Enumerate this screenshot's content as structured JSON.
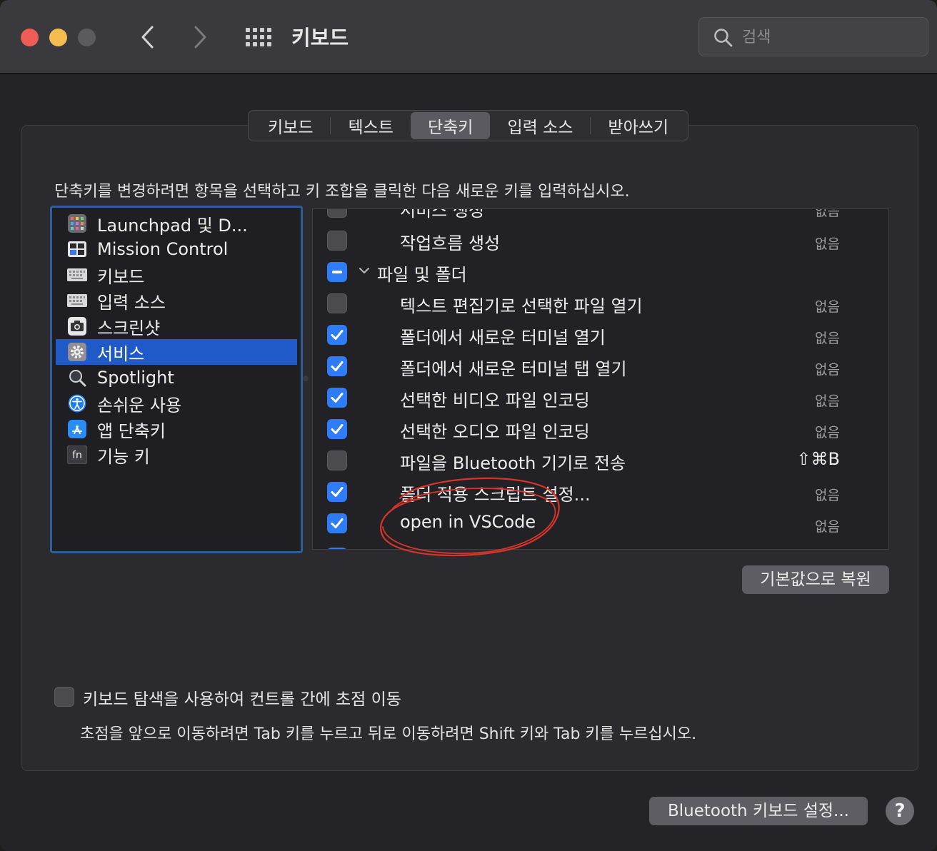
{
  "window": {
    "title": "키보드",
    "search_placeholder": "검색"
  },
  "tabs": [
    {
      "label": "키보드",
      "active": false
    },
    {
      "label": "텍스트",
      "active": false
    },
    {
      "label": "단축키",
      "active": true
    },
    {
      "label": "입력 소스",
      "active": false
    },
    {
      "label": "받아쓰기",
      "active": false
    }
  ],
  "instruction": "단축키를 변경하려면 항목을 선택하고 키 조합을 클릭한 다음 새로운 키를 입력하십시오.",
  "categories": [
    {
      "label": "Launchpad 및 D...",
      "icon": "launchpad-icon"
    },
    {
      "label": "Mission Control",
      "icon": "mission-control-icon"
    },
    {
      "label": "키보드",
      "icon": "keyboard-icon"
    },
    {
      "label": "입력 소스",
      "icon": "keyboard-icon"
    },
    {
      "label": "스크린샷",
      "icon": "screenshot-icon"
    },
    {
      "label": "서비스",
      "icon": "gear-icon",
      "selected": true
    },
    {
      "label": "Spotlight",
      "icon": "magnifier-icon"
    },
    {
      "label": "손쉬운 사용",
      "icon": "accessibility-icon"
    },
    {
      "label": "앱 단축키",
      "icon": "app-store-icon"
    },
    {
      "label": "기능 키",
      "icon": "fn-key-icon"
    }
  ],
  "shortcuts": [
    {
      "label": "서비스 생성",
      "key": "없음",
      "state": "off",
      "partial": true
    },
    {
      "label": "작업흐름 생성",
      "key": "없음",
      "state": "off"
    },
    {
      "label": "파일 및 폴더",
      "key": "",
      "state": "mixed",
      "group": true
    },
    {
      "label": "텍스트 편집기로 선택한 파일 열기",
      "key": "없음",
      "state": "off"
    },
    {
      "label": "폴더에서 새로운 터미널 열기",
      "key": "없음",
      "state": "on"
    },
    {
      "label": "폴더에서 새로운 터미널 탭 열기",
      "key": "없음",
      "state": "on"
    },
    {
      "label": "선택한 비디오 파일 인코딩",
      "key": "없음",
      "state": "on"
    },
    {
      "label": "선택한 오디오 파일 인코딩",
      "key": "없음",
      "state": "on"
    },
    {
      "label": "파일을 Bluetooth 기기로 전송",
      "key": "⇧⌘B",
      "state": "off",
      "bold_key": true
    },
    {
      "label": "폴더 적용 스크립트 설정...",
      "key": "없음",
      "state": "on"
    },
    {
      "label": "open in VSCode",
      "key": "없음",
      "state": "on"
    }
  ],
  "restore_button": "기본값으로 복원",
  "keyboard_nav": {
    "label": "키보드 탐색을 사용하여 컨트롤 간에 초점 이동",
    "hint": "초점을 앞으로 이동하려면 Tab 키를 누르고 뒤로 이동하려면 Shift 키와 Tab 키를 누르십시오."
  },
  "bluetooth_button": "Bluetooth 키보드 설정...",
  "help_button": "?",
  "colors": {
    "accent": "#2f7cf6",
    "selection": "#1f5ac8",
    "annotation": "#d8352a"
  }
}
